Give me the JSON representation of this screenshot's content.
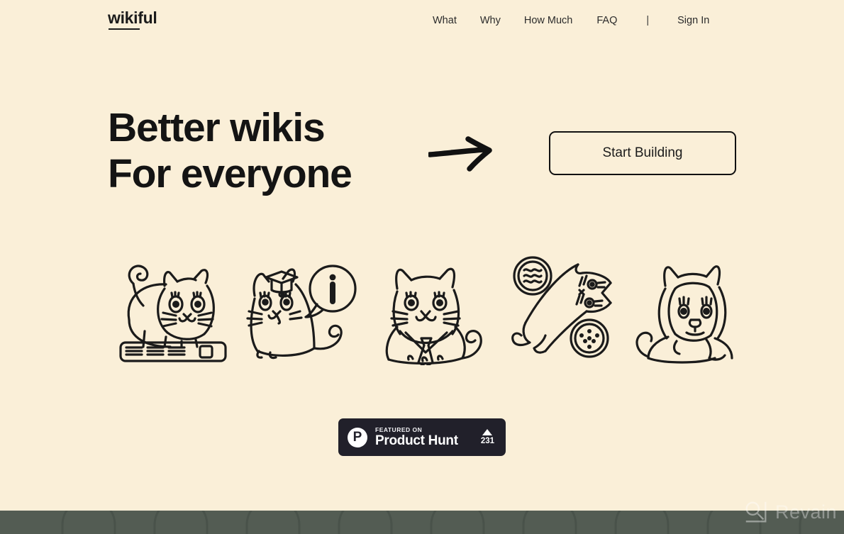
{
  "page": {
    "background_color": "#FAEFD8",
    "text_color": "#1b1b1b"
  },
  "header": {
    "logo_text": "wikiful",
    "nav": [
      {
        "label": "What",
        "name": "nav-link-what"
      },
      {
        "label": "Why",
        "name": "nav-link-why"
      },
      {
        "label": "How Much",
        "name": "nav-link-how-much"
      },
      {
        "label": "FAQ",
        "name": "nav-link-faq"
      }
    ],
    "divider": "|",
    "sign_in_label": "Sign In"
  },
  "hero": {
    "headline_line1": "Better wikis",
    "headline_line2": "For everyone",
    "arrow_icon": "arrow-right-icon",
    "cta_label": "Start Building"
  },
  "illustrations": {
    "items": [
      {
        "name": "cat-on-keyboard",
        "alt": "Cat standing on a keyboard"
      },
      {
        "name": "graduate-cat-info",
        "alt": "Graduate cat with info speech bubble"
      },
      {
        "name": "business-cat-necktie",
        "alt": "Cat wearing a necktie"
      },
      {
        "name": "tilted-cat-badges",
        "alt": "Tilted cat with two round badges"
      },
      {
        "name": "hoodie-cat",
        "alt": "Cat wearing a hoodie with ears"
      }
    ]
  },
  "product_hunt": {
    "logo_letter": "P",
    "featured_label": "FEATURED ON",
    "name_label": "Product Hunt",
    "upvote_icon": "triangle-up-icon",
    "upvote_count": "231",
    "background_color": "#21202a"
  },
  "footer_band": {
    "background_color": "#535C53",
    "arch_color": "#49524A"
  },
  "watermark": {
    "text": "Revain",
    "icon": "revain-logo-icon"
  }
}
